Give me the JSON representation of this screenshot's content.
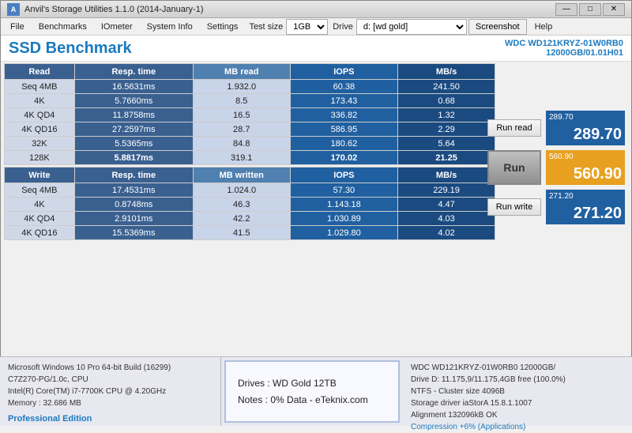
{
  "window": {
    "title": "Anvil's Storage Utilities 1.1.0 (2014-January-1)",
    "icon_label": "A"
  },
  "titlebar": {
    "minimize": "—",
    "maximize": "□",
    "close": "✕"
  },
  "menu": {
    "file": "File",
    "benchmarks": "Benchmarks",
    "iometer": "IOmeter",
    "system_info": "System Info",
    "settings": "Settings",
    "test_size_label": "Test size",
    "test_size_value": "1GB",
    "drive_label": "Drive",
    "drive_value": "d: [wd gold]",
    "screenshot": "Screenshot",
    "help": "Help"
  },
  "ssd": {
    "title": "SSD Benchmark",
    "drive_info_line1": "WDC WD121KRYZ-01W0RB0",
    "drive_info_line2": "12000GB/01.01H01"
  },
  "read_table": {
    "headers": [
      "Read",
      "Resp. time",
      "MB read",
      "IOPS",
      "MB/s"
    ],
    "rows": [
      {
        "label": "Seq 4MB",
        "resp": "16.5631ms",
        "mb": "1.932.0",
        "iops": "60.38",
        "mbs": "241.50"
      },
      {
        "label": "4K",
        "resp": "5.7660ms",
        "mb": "8.5",
        "iops": "173.43",
        "mbs": "0.68"
      },
      {
        "label": "4K QD4",
        "resp": "11.8758ms",
        "mb": "16.5",
        "iops": "336.82",
        "mbs": "1.32"
      },
      {
        "label": "4K QD16",
        "resp": "27.2597ms",
        "mb": "28.7",
        "iops": "586.95",
        "mbs": "2.29"
      },
      {
        "label": "32K",
        "resp": "5.5365ms",
        "mb": "84.8",
        "iops": "180.62",
        "mbs": "5.64"
      },
      {
        "label": "128K",
        "resp": "5.8817ms",
        "mb": "319.1",
        "iops": "170.02",
        "mbs": "21.25"
      }
    ]
  },
  "write_table": {
    "headers": [
      "Write",
      "Resp. time",
      "MB written",
      "IOPS",
      "MB/s"
    ],
    "rows": [
      {
        "label": "Seq 4MB",
        "resp": "17.4531ms",
        "mb": "1.024.0",
        "iops": "57.30",
        "mbs": "229.19"
      },
      {
        "label": "4K",
        "resp": "0.8748ms",
        "mb": "46.3",
        "iops": "1.143.18",
        "mbs": "4.47"
      },
      {
        "label": "4K QD4",
        "resp": "2.9101ms",
        "mb": "42.2",
        "iops": "1.030.89",
        "mbs": "4.03"
      },
      {
        "label": "4K QD16",
        "resp": "15.5369ms",
        "mb": "41.5",
        "iops": "1.029.80",
        "mbs": "4.02"
      }
    ]
  },
  "scores": {
    "read_label": "289.70",
    "read_value": "289.70",
    "total_label": "560.90",
    "total_value": "560.90",
    "write_label": "271.20",
    "write_value": "271.20"
  },
  "buttons": {
    "run_read": "Run read",
    "run": "Run",
    "run_write": "Run write"
  },
  "bottom": {
    "sys_info": "Microsoft Windows 10 Pro 64-bit Build (16299)",
    "cpu_model": "C7Z270-PG/1.0c, CPU",
    "cpu_detail": "Intel(R) Core(TM) i7-7700K CPU @ 4.20GHz",
    "memory": "Memory : 32.686 MB",
    "professional": "Professional Edition",
    "drives_note": "Drives : WD Gold 12TB",
    "notes": "Notes : 0% Data - eTeknix.com",
    "drive_model": "WDC WD121KRYZ-01W0RB0 12000GB/",
    "drive_info": "Drive D: 11.175,9/11.175,4GB free (100.0%)",
    "fs_info": "NTFS - Cluster size 4096B",
    "storage_driver": "Storage driver  iaStorA 15.8.1.1007",
    "alignment": "Alignment 132096kB OK",
    "compression": "Compression +6% (Applications)"
  }
}
